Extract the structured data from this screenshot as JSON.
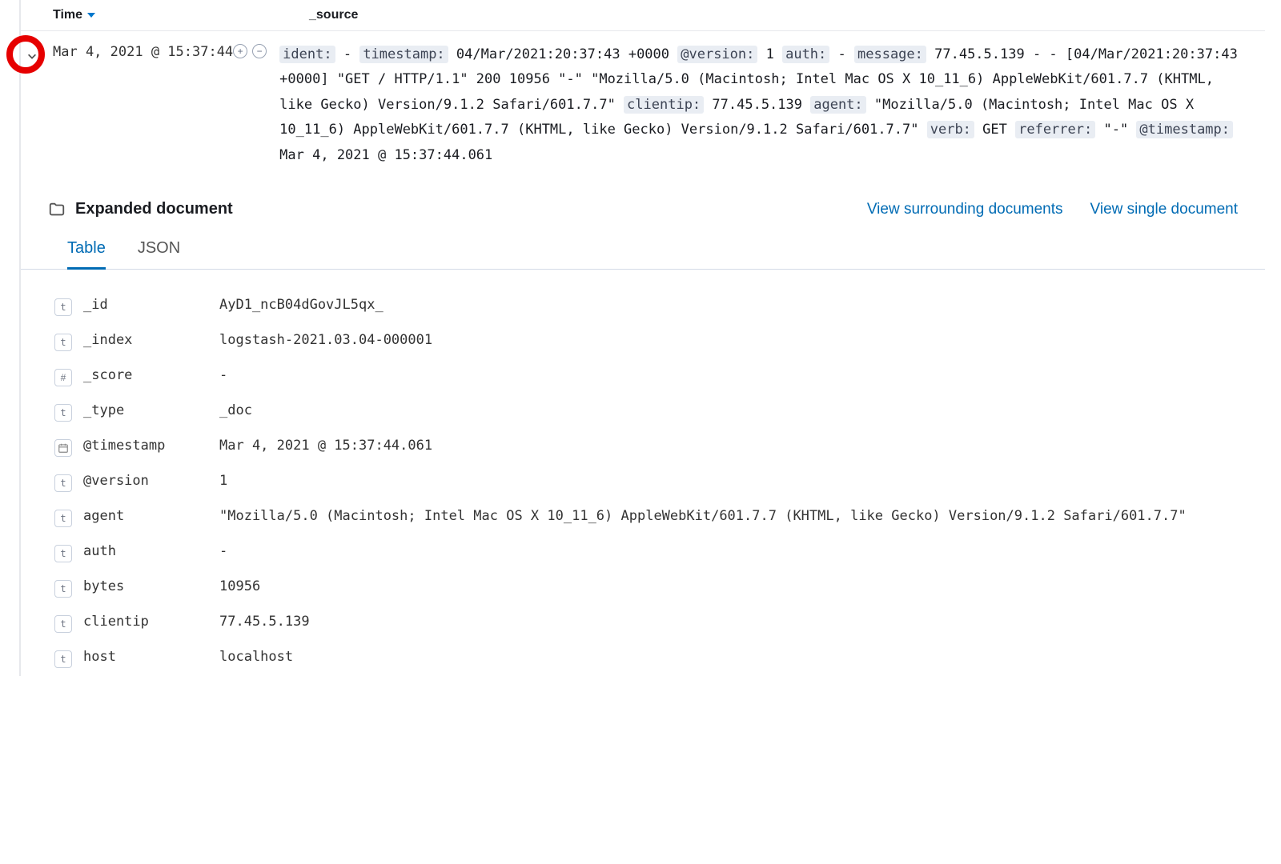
{
  "columns": {
    "time": "Time",
    "source": "_source"
  },
  "row": {
    "time": "Mar 4, 2021 @ 15:37:44",
    "source_segments": [
      {
        "k": "ident:",
        "v": " - "
      },
      {
        "k": "timestamp:",
        "v": " 04/Mar/2021:20:37:43 +0000 "
      },
      {
        "k": "@version:",
        "v": " 1 "
      },
      {
        "k": "auth:",
        "v": " - "
      },
      {
        "k": "message:",
        "v": " 77.45.5.139 - - [04/Mar/2021:20:37:43 +0000] \"GET / HTTP/1.1\" 200 10956 \"-\" \"Mozilla/5.0 (Macintosh; Intel Mac OS X 10_11_6) AppleWebKit/601.7.7 (KHTML, like Gecko) Version/9.1.2 Safari/601.7.7\" "
      },
      {
        "k": "clientip:",
        "v": " 77.45.5.139 "
      },
      {
        "k": "agent:",
        "v": " \"Mozilla/5.0 (Macintosh; Intel Mac OS X 10_11_6) AppleWebKit/601.7.7 (KHTML, like Gecko) Version/9.1.2 Safari/601.7.7\" "
      },
      {
        "k": "verb:",
        "v": " GET "
      },
      {
        "k": "referrer:",
        "v": " \"-\" "
      },
      {
        "k": "@timestamp:",
        "v": " Mar 4, 2021 @ 15:37:44.061"
      }
    ]
  },
  "expanded": {
    "title": "Expanded document",
    "links": {
      "surrounding": "View surrounding documents",
      "single": "View single document"
    },
    "tabs": {
      "table": "Table",
      "json": "JSON"
    }
  },
  "fields": [
    {
      "type": "t",
      "name": "_id",
      "value": "AyD1_ncB04dGovJL5qx_"
    },
    {
      "type": "t",
      "name": "_index",
      "value": "logstash-2021.03.04-000001"
    },
    {
      "type": "#",
      "name": "_score",
      "value": " - "
    },
    {
      "type": "t",
      "name": "_type",
      "value": "_doc"
    },
    {
      "type": "d",
      "name": "@timestamp",
      "value": "Mar 4, 2021 @ 15:37:44.061"
    },
    {
      "type": "t",
      "name": "@version",
      "value": "1"
    },
    {
      "type": "t",
      "name": "agent",
      "value": "\"Mozilla/5.0 (Macintosh; Intel Mac OS X 10_11_6) AppleWebKit/601.7.7 (KHTML, like Gecko) Version/9.1.2 Safari/601.7.7\""
    },
    {
      "type": "t",
      "name": "auth",
      "value": "-"
    },
    {
      "type": "t",
      "name": "bytes",
      "value": "10956"
    },
    {
      "type": "t",
      "name": "clientip",
      "value": "77.45.5.139"
    },
    {
      "type": "t",
      "name": "host",
      "value": "localhost"
    }
  ],
  "type_badges": {
    "t": "t",
    "#": "#",
    "d": "📅"
  }
}
